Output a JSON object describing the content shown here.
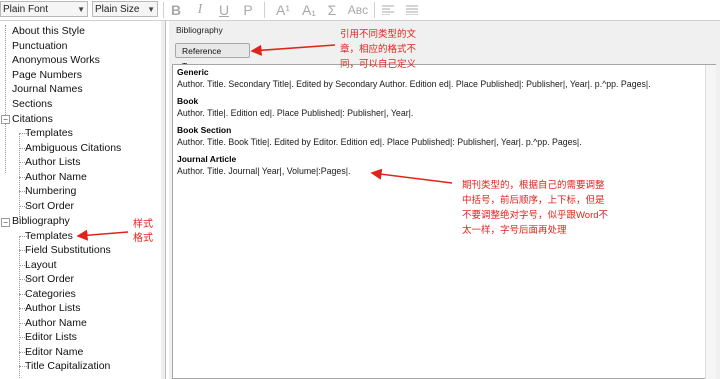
{
  "toolbar": {
    "font_select": "Plain Font",
    "size_select": "Plain Size",
    "bold": "B",
    "italic": "I",
    "underline": "U",
    "plain": "P",
    "superscript": "A¹",
    "subscript": "A₁",
    "symbol": "Σ",
    "small_caps": "Aʙᴄ"
  },
  "tree": {
    "items": [
      {
        "label": "About this Style"
      },
      {
        "label": "Punctuation"
      },
      {
        "label": "Anonymous Works"
      },
      {
        "label": "Page Numbers"
      },
      {
        "label": "Journal Names"
      },
      {
        "label": "Sections"
      },
      {
        "label": "Citations"
      },
      {
        "label": "Templates"
      },
      {
        "label": "Ambiguous Citations"
      },
      {
        "label": "Author Lists"
      },
      {
        "label": "Author Name"
      },
      {
        "label": "Numbering"
      },
      {
        "label": "Sort Order"
      },
      {
        "label": "Bibliography"
      },
      {
        "label": "Templates"
      },
      {
        "label": "Field Substitutions"
      },
      {
        "label": "Layout"
      },
      {
        "label": "Sort Order"
      },
      {
        "label": "Categories"
      },
      {
        "label": "Author Lists"
      },
      {
        "label": "Author Name"
      },
      {
        "label": "Editor Lists"
      },
      {
        "label": "Editor Name"
      },
      {
        "label": "Title Capitalization"
      }
    ]
  },
  "panel": {
    "title": "Bibliography",
    "ref_types_button": "Reference Types▸"
  },
  "templates": {
    "generic_header": "Generic",
    "generic_line": "Author. Title. Secondary Title|. Edited by Secondary Author. Edition ed|. Place Published|: Publisher|, Year|. p.^pp. Pages|.",
    "book_header": "Book",
    "book_line": "Author. Title|. Edition ed|. Place Published|: Publisher|, Year|.",
    "section_header": "Book Section",
    "section_line": "Author. Title. Book Title|. Edited by Editor. Edition ed|. Place Published|: Publisher|, Year|. p.^pp. Pages|.",
    "journal_header": "Journal Article",
    "journal_line": "Author. Title. Journal| Year|, Volume|:Pages|."
  },
  "annotations": {
    "note1_line1": "引用不同类型的文",
    "note1_line2": "章，相应的格式不",
    "note1_line3": "同，可以自己定义",
    "note2_line1": "样式",
    "note2_line2": "格式",
    "note3_line1": "期刊类型的，根据自己的需要调整",
    "note3_line2": "中括号，前后顺序，上下标，但是",
    "note3_line3": "不要调整绝对字号，似乎跟Word不",
    "note3_line4": "太一样，字号后面再处理"
  },
  "colors": {
    "annotation_red": "#e0241b"
  }
}
